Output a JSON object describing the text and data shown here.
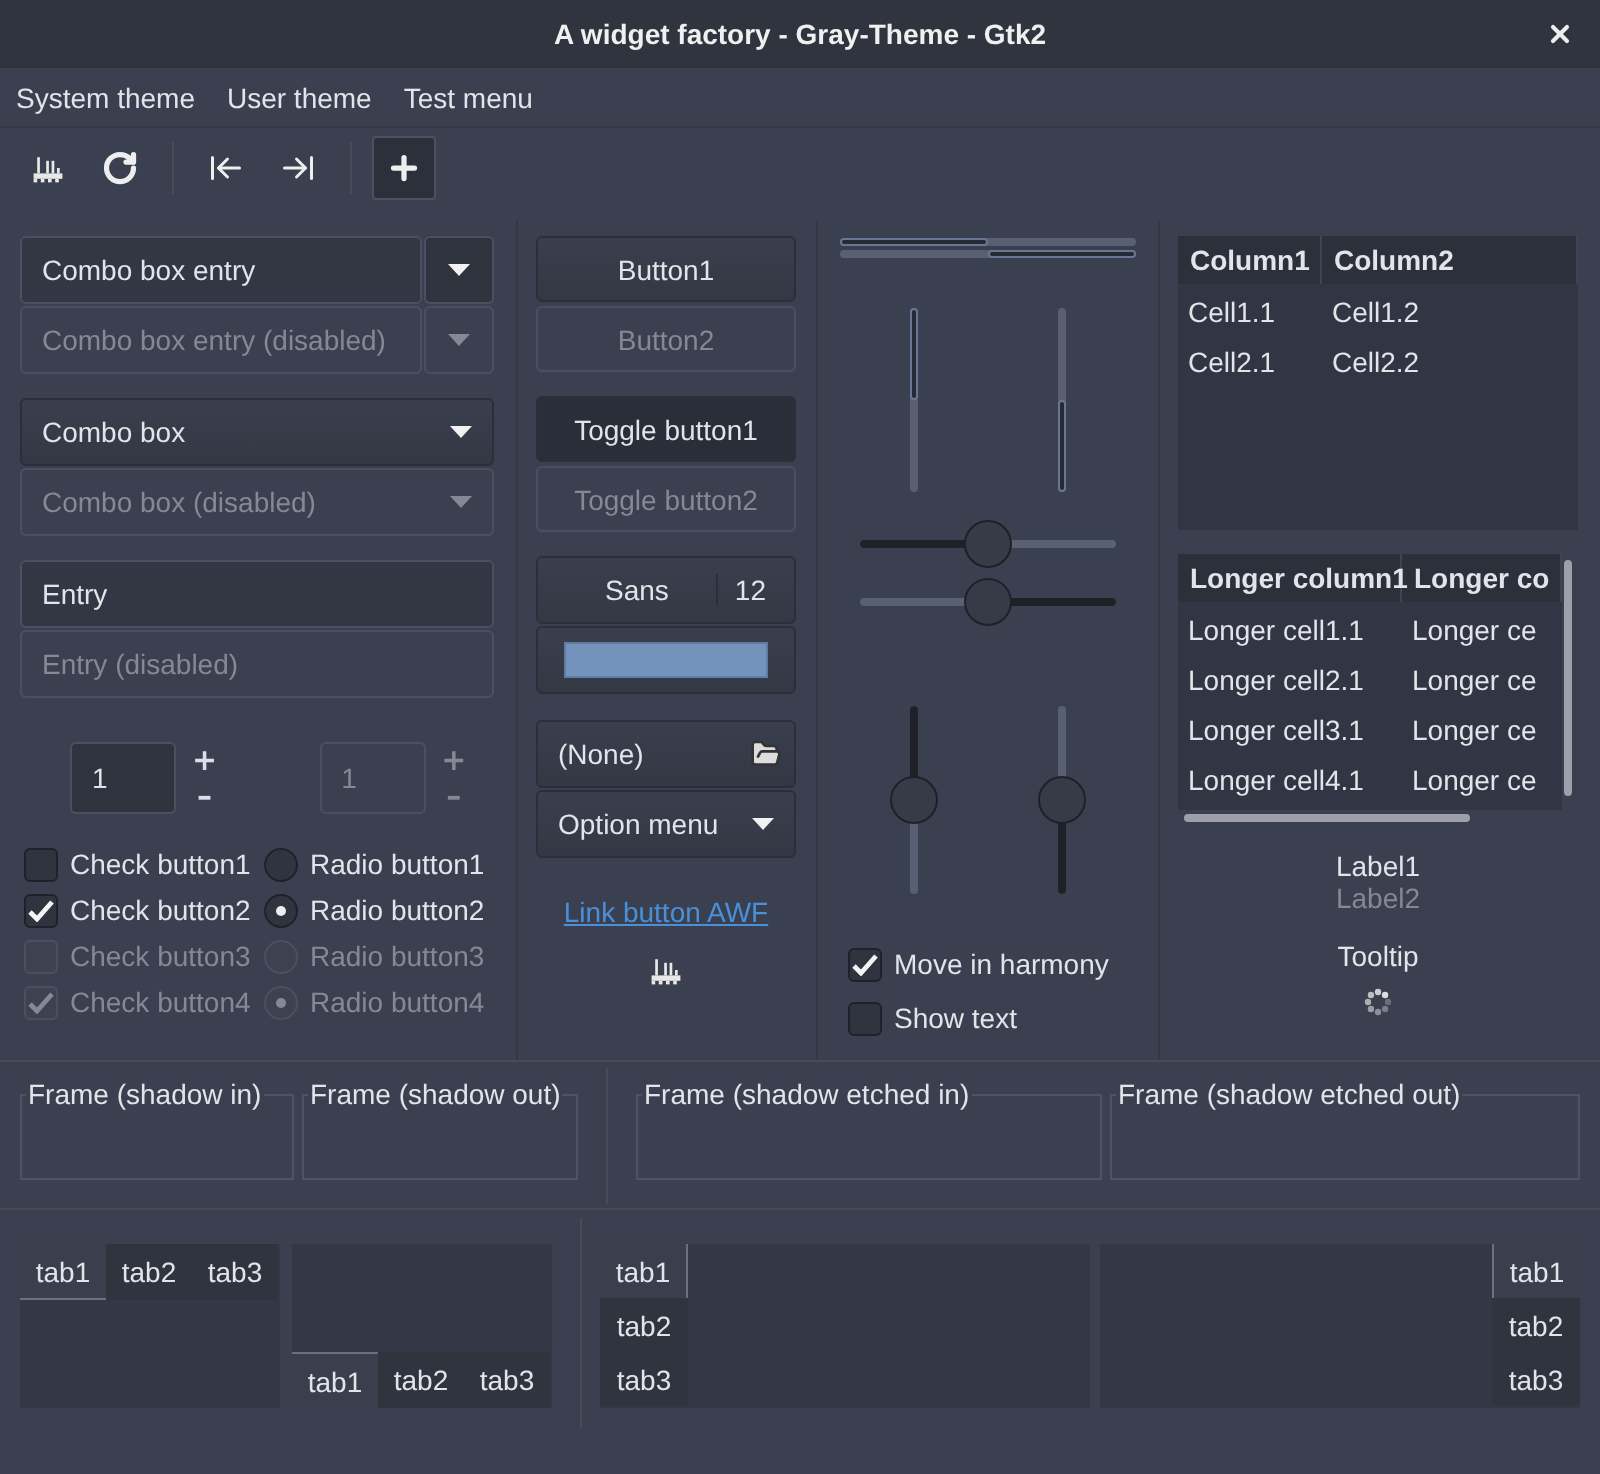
{
  "window": {
    "title": "A widget factory - Gray-Theme - Gtk2"
  },
  "menu": [
    "System theme",
    "User theme",
    "Test menu"
  ],
  "toolbar": [
    [
      {
        "kind": "factory",
        "active": false
      },
      {
        "kind": "refresh",
        "active": false
      }
    ],
    [
      {
        "kind": "go-first",
        "active": false
      },
      {
        "kind": "go-last",
        "active": false
      }
    ],
    [
      {
        "kind": "add",
        "active": true
      }
    ]
  ],
  "combo_entries": [
    {
      "value": "Combo box entry",
      "disabled": false
    },
    {
      "value": "Combo box entry (disabled)",
      "disabled": true
    }
  ],
  "combos": [
    {
      "value": "Combo box",
      "disabled": false
    },
    {
      "value": "Combo box (disabled)",
      "disabled": true
    }
  ],
  "entries": [
    {
      "value": "Entry",
      "disabled": false
    },
    {
      "placeholder": "Entry (disabled)",
      "disabled": true
    }
  ],
  "spinners": [
    {
      "value": "1",
      "increment": "+",
      "decrement": "–",
      "disabled": false
    },
    {
      "value": "1",
      "increment": "+",
      "decrement": "–",
      "disabled": true
    }
  ],
  "checks": [
    {
      "label": "Check button1",
      "checked": false,
      "disabled": false
    },
    {
      "label": "Check button2",
      "checked": true,
      "disabled": false
    },
    {
      "label": "Check button3",
      "checked": false,
      "disabled": true
    },
    {
      "label": "Check button4",
      "checked": true,
      "disabled": true
    }
  ],
  "radios": [
    {
      "label": "Radio button1",
      "selected": false,
      "disabled": false
    },
    {
      "label": "Radio button2",
      "selected": true,
      "disabled": false
    },
    {
      "label": "Radio button3",
      "selected": false,
      "disabled": true
    },
    {
      "label": "Radio button4",
      "selected": true,
      "disabled": true
    }
  ],
  "buttons": [
    {
      "label": "Button1",
      "disabled": false
    },
    {
      "label": "Button2",
      "disabled": true
    }
  ],
  "toggles": [
    {
      "label": "Toggle button1",
      "on": true,
      "disabled": false
    },
    {
      "label": "Toggle button2",
      "on": false,
      "disabled": true
    }
  ],
  "font_button": {
    "family": "Sans",
    "size": "12"
  },
  "color_button": {
    "color": "#7393bd"
  },
  "file_chooser": {
    "value": "(None)"
  },
  "option_menu": {
    "label": "Option menu"
  },
  "link": {
    "label": "Link button AWF"
  },
  "progress_h": [
    {
      "level": 0.5,
      "kind": "forward"
    },
    {
      "level": 0.5,
      "kind": "reverse"
    }
  ],
  "progress_v": [
    {
      "level": 0.5,
      "kind": "reverse"
    },
    {
      "level": 0.5,
      "kind": "forward"
    }
  ],
  "scales_h": [
    {
      "level": 0.5,
      "kind": "forward"
    },
    {
      "level": 0.5,
      "kind": "reverse"
    }
  ],
  "scales_v": [
    {
      "level": 0.5,
      "kind": "reverse"
    },
    {
      "level": 0.5,
      "kind": "forward"
    }
  ],
  "options": [
    {
      "label": "Move in harmony",
      "checked": true
    },
    {
      "label": "Show text",
      "checked": false
    }
  ],
  "tree1": {
    "columns": [
      "Column1",
      "Column2"
    ],
    "rows": [
      [
        "Cell1.1",
        "Cell1.2"
      ],
      [
        "Cell2.1",
        "Cell2.2"
      ]
    ]
  },
  "tree2": {
    "columns": [
      "Longer column1",
      "Longer co"
    ],
    "rows": [
      [
        "Longer cell1.1",
        "Longer ce"
      ],
      [
        "Longer cell2.1",
        "Longer ce"
      ],
      [
        "Longer cell3.1",
        "Longer ce"
      ],
      [
        "Longer cell4.1",
        "Longer ce"
      ]
    ]
  },
  "labels": [
    {
      "text": "Label1",
      "disabled": false
    },
    {
      "text": "Label2",
      "disabled": true
    }
  ],
  "tooltip_label": "Tooltip",
  "frames": [
    "Frame (shadow in)",
    "Frame (shadow out)",
    "Frame (shadow etched in)",
    "Frame (shadow etched out)"
  ],
  "notebooks": [
    {
      "kind": "top",
      "tabs": [
        {
          "label": "tab1",
          "selected": true
        },
        {
          "label": "tab2",
          "selected": false
        },
        {
          "label": "tab3",
          "selected": false
        }
      ]
    },
    {
      "kind": "bottom",
      "tabs": [
        {
          "label": "tab1",
          "selected": true
        },
        {
          "label": "tab2",
          "selected": false
        },
        {
          "label": "tab3",
          "selected": false
        }
      ]
    },
    {
      "kind": "left",
      "tabs": [
        {
          "label": "tab1",
          "selected": true
        },
        {
          "label": "tab2",
          "selected": false
        },
        {
          "label": "tab3",
          "selected": false
        }
      ]
    },
    {
      "kind": "right",
      "tabs": [
        {
          "label": "tab1",
          "selected": true
        },
        {
          "label": "tab2",
          "selected": false
        },
        {
          "label": "tab3",
          "selected": false
        }
      ]
    }
  ]
}
